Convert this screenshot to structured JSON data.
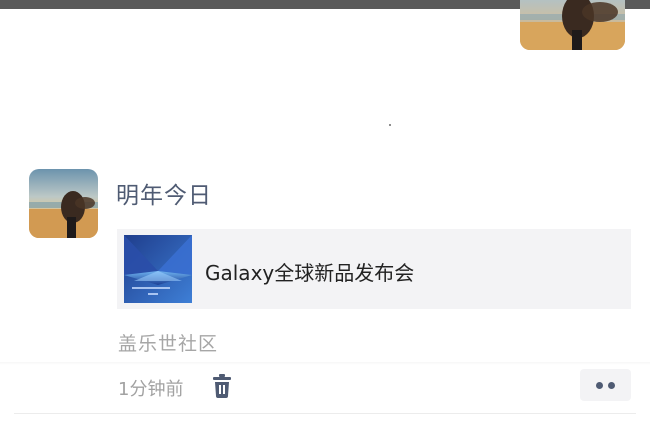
{
  "post": {
    "username": "明年今日",
    "link_card": {
      "title": "Galaxy全球新品发布会"
    },
    "source": "盖乐世社区",
    "timestamp": "1分钟前",
    "delete_icon": "trash-icon",
    "more_icon": "more-dots-icon"
  },
  "colors": {
    "username": "#4f5b73",
    "card_background": "#f3f3f5",
    "secondary_text": "#a6a6a6",
    "top_bar": "#5a5a5a"
  }
}
